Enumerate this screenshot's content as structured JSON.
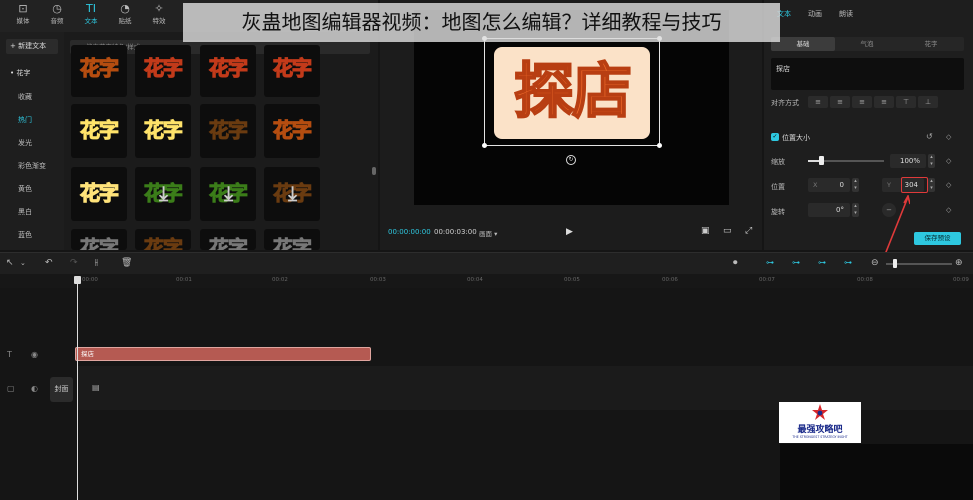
{
  "banner": {
    "text": "灰蛊地图编辑器视频：地图怎么编辑？详细教程与技巧"
  },
  "toolbar": {
    "tools": [
      {
        "label": "媒体",
        "icon": "media-icon"
      },
      {
        "label": "音频",
        "icon": "audio-icon"
      },
      {
        "label": "文本",
        "icon": "text-icon",
        "active": true
      },
      {
        "label": "贴纸",
        "icon": "sticker-icon"
      },
      {
        "label": "特效",
        "icon": "effects-icon"
      }
    ]
  },
  "sidebar": {
    "new_text": "+ 新建文本",
    "items": [
      "• 花字",
      "收藏",
      "热门",
      "发光",
      "彩色渐变",
      "黄色",
      "黑白",
      "蓝色"
    ]
  },
  "effects": {
    "search_placeholder": "搜索花字特色/样式",
    "tile_text": "花字"
  },
  "preview": {
    "overlay_text": "探店",
    "time_current": "00:00:00:00",
    "time_total": "00:00:03:00",
    "ratio_label": "画面 ▾"
  },
  "properties": {
    "tabs": [
      "文本",
      "动画",
      "朗读"
    ],
    "subtabs": [
      "基础",
      "气泡",
      "花字"
    ],
    "text_value": "探店",
    "align_label": "对齐方式",
    "position_size_label": "位置大小",
    "scale_label": "缩放",
    "scale_value": "100%",
    "scale_fraction": 0.17,
    "position_label": "位置",
    "x_prefix": "X",
    "x_value": "0",
    "y_prefix": "Y",
    "y_value": "304",
    "rotate_label": "旋转",
    "rotate_value": "0°",
    "save_preset": "保存预设",
    "accent_color": "#2ec8e0"
  },
  "timeline": {
    "ticks": [
      "00:00",
      "00:01",
      "00:02",
      "00:03",
      "00:04",
      "00:05",
      "00:06",
      "00:07",
      "00:08",
      "00:09"
    ],
    "text_clip_label": "探店",
    "cover_label": "封面",
    "clip_color": "#b55a52"
  },
  "logo": {
    "text": "最强攻略吧",
    "sub": "THE STRONGEST STRATEGY INGHT"
  }
}
